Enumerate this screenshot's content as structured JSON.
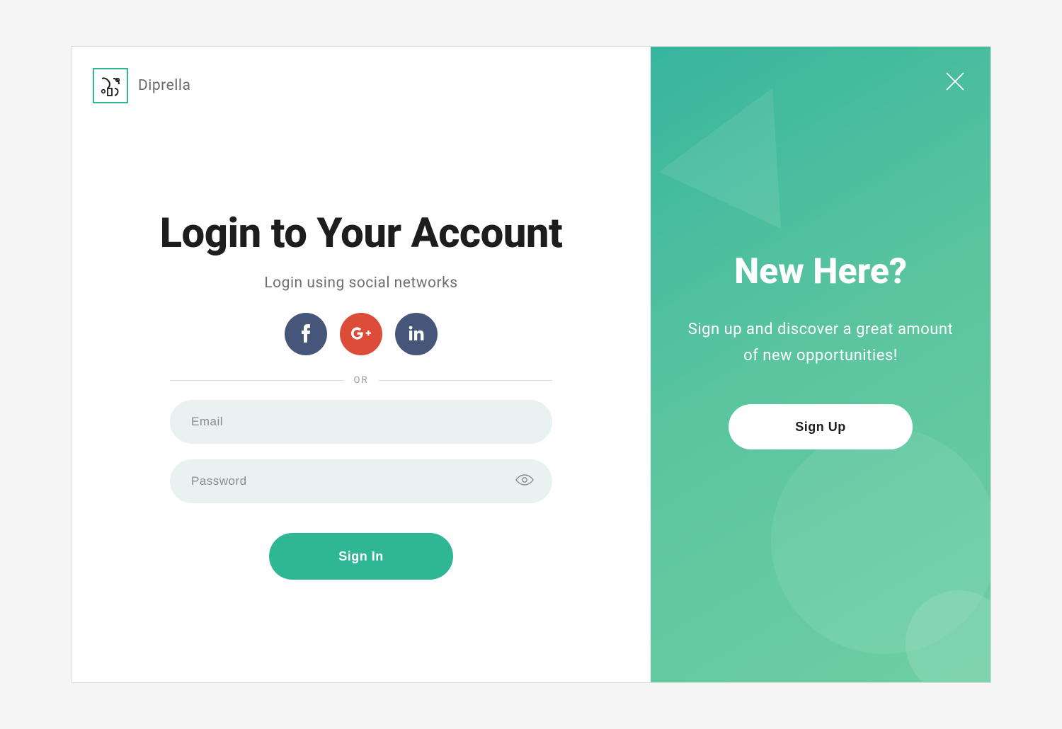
{
  "brand": {
    "name": "Diprella"
  },
  "login": {
    "title": "Login to Your Account",
    "subtitle": "Login using social networks",
    "divider": "OR",
    "email_placeholder": "Email",
    "password_placeholder": "Password",
    "signin_label": "Sign In",
    "social": {
      "facebook": "facebook-icon",
      "googleplus": "google-plus-icon",
      "linkedin": "linkedin-icon"
    }
  },
  "signup_panel": {
    "title": "New Here?",
    "subtitle": "Sign up and discover a great amount of new opportunities!",
    "signup_label": "Sign Up"
  },
  "colors": {
    "accent": "#2fb795",
    "social_fb": "#46557a",
    "social_gp": "#dd4c39",
    "social_li": "#46557a"
  }
}
